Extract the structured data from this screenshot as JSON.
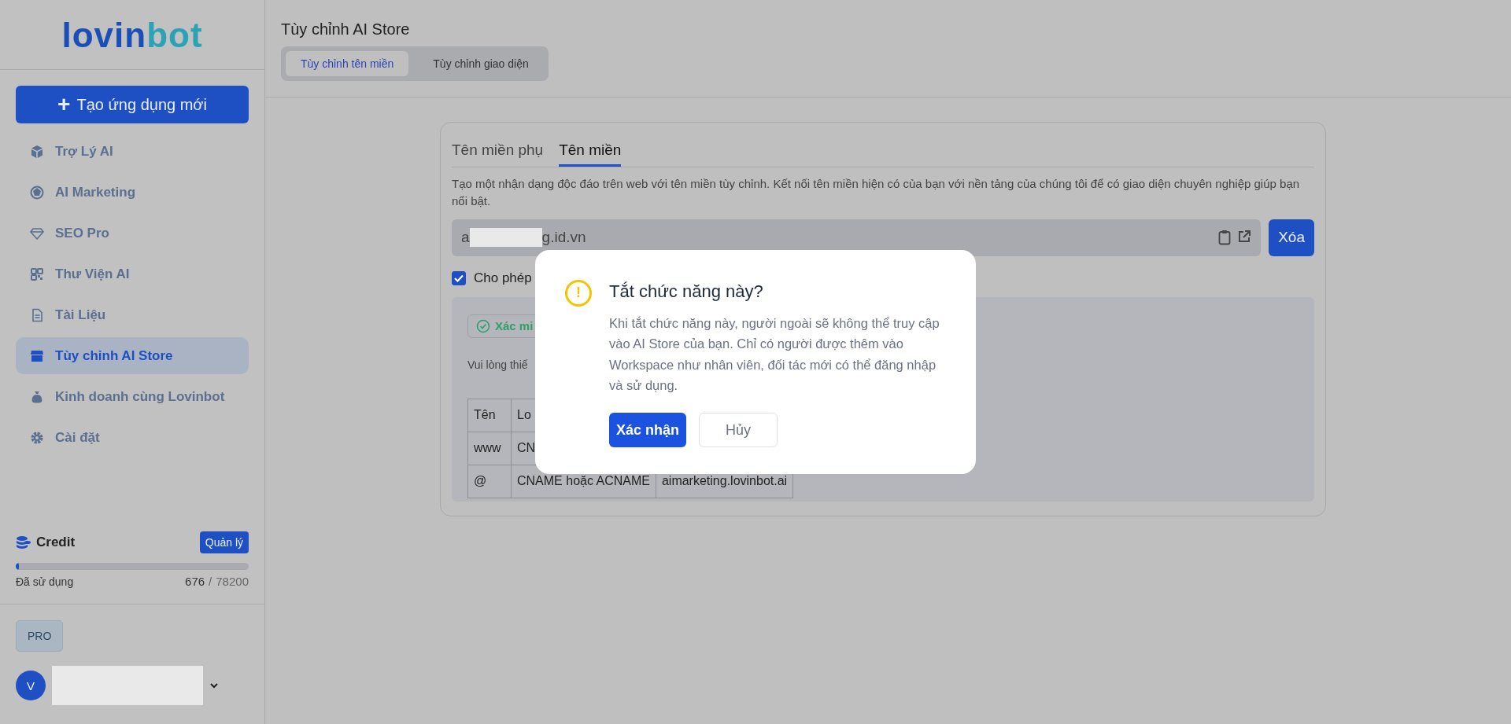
{
  "sidebar": {
    "logo": {
      "part1": "lovin",
      "part2": "bot"
    },
    "create_button": {
      "icon": "+",
      "label": "Tạo ứng dụng mới"
    },
    "items": [
      {
        "label": "Trợ Lý AI",
        "selected": false
      },
      {
        "label": "AI Marketing",
        "selected": false
      },
      {
        "label": "SEO Pro",
        "selected": false
      },
      {
        "label": "Thư Viện AI",
        "selected": false
      },
      {
        "label": "Tài Liệu",
        "selected": false
      },
      {
        "label": "Tùy chỉnh AI Store",
        "selected": true
      },
      {
        "label": "Kinh doanh cùng Lovinbot",
        "selected": false
      },
      {
        "label": "Cài đặt",
        "selected": false
      }
    ],
    "credit": {
      "title": "Credit",
      "manage_button": "Quản lý",
      "level": 0.0086,
      "used_label": "Đã sử dụng",
      "used": "676",
      "separator": "/",
      "total": "78200"
    },
    "plan_badge": "PRO",
    "user": {
      "initial": "V"
    }
  },
  "page": {
    "title": "Tùy chỉnh AI Store",
    "tabs": [
      {
        "label": "Tùy chỉnh tên miền",
        "selected": true
      },
      {
        "label": "Tùy chỉnh giao diện",
        "selected": false
      }
    ]
  },
  "card": {
    "tabs": [
      {
        "label": "Tên miền phụ",
        "selected": false
      },
      {
        "label": "Tên miền",
        "selected": true
      }
    ],
    "description": "Tạo một nhận dạng độc đáo trên web với tên miền tùy chỉnh. Kết nối tên miền hiện có của bạn với nền tảng của chúng tôi để có giao diện chuyên nghiệp giúp bạn nổi bật.",
    "domain": {
      "value_start": "a",
      "value_end": "g.id.vn"
    },
    "delete_button": "Xóa",
    "allow": {
      "label": "Cho phép",
      "checked": true
    },
    "verify_badge": "Xác mi",
    "instruction": "Vui lòng thiế",
    "table": {
      "columns": [
        "Tên",
        "Lo"
      ],
      "rows": [
        [
          "www",
          "CN"
        ],
        [
          "@",
          "CNAME hoặc ACNAME",
          "aimarketing.lovinbot.ai"
        ]
      ]
    }
  },
  "dialog": {
    "icon": "!",
    "title": "Tắt chức năng này?",
    "message": "Khi tắt chức năng này, người ngoài sẽ không thể truy cập vào AI Store của bạn. Chỉ có người được thêm vào Workspace như nhân viên, đối tác mới có thể đăng nhập và sử dụng.",
    "buttons": [
      {
        "label": "Xác nhận",
        "kind": "primary"
      },
      {
        "label": "Hủy",
        "kind": "secondary"
      }
    ]
  }
}
